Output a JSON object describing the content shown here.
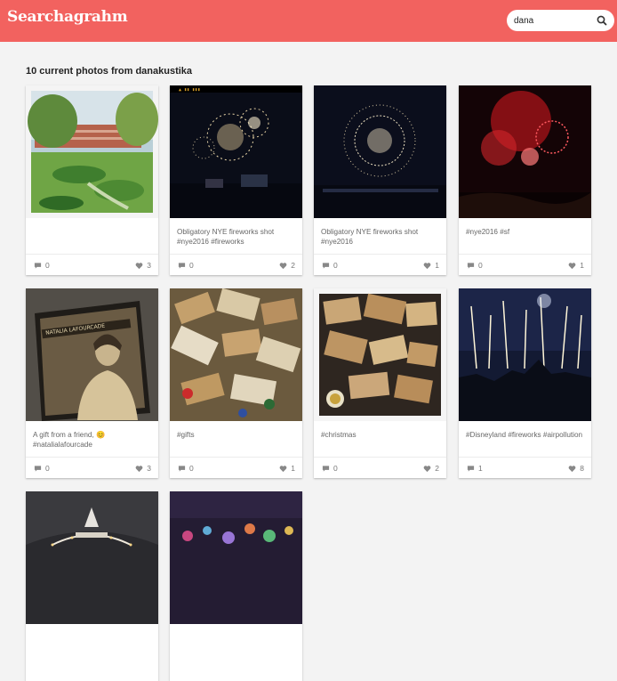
{
  "app": {
    "title": "Searchagrahm"
  },
  "search": {
    "value": "dana",
    "placeholder": ""
  },
  "heading": "10 current photos from danakustika",
  "colors": {
    "brand": "#f2625f"
  },
  "icons": {
    "search": "search-icon",
    "comment": "comment-icon",
    "like": "heart-icon"
  },
  "photos": [
    {
      "caption": "",
      "comments": "0",
      "likes": "3"
    },
    {
      "caption": "Obligatory NYE fireworks shot #nye2016 #fireworks",
      "comments": "0",
      "likes": "2"
    },
    {
      "caption": "Obligatory NYE fireworks shot #nye2016",
      "comments": "0",
      "likes": "1"
    },
    {
      "caption": "#nye2016 #sf",
      "comments": "0",
      "likes": "1"
    },
    {
      "caption": "A gift from a friend, 😊 #natalialafourcade",
      "comments": "0",
      "likes": "3"
    },
    {
      "caption": "#gifts",
      "comments": "0",
      "likes": "1"
    },
    {
      "caption": "#christmas",
      "comments": "0",
      "likes": "2"
    },
    {
      "caption": "#Disneyland #fireworks #airpollution",
      "comments": "1",
      "likes": "8"
    },
    {
      "caption": "",
      "comments": "",
      "likes": ""
    },
    {
      "caption": "",
      "comments": "",
      "likes": ""
    }
  ]
}
